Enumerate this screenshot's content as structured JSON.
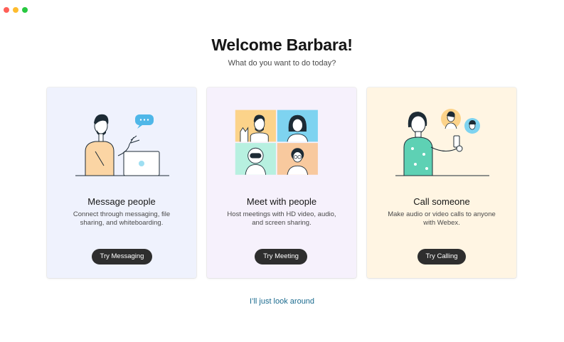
{
  "window": {
    "controls": [
      "close",
      "minimize",
      "zoom"
    ]
  },
  "header": {
    "title": "Welcome Barbara!",
    "subtitle": "What do you want to do today?"
  },
  "cards": [
    {
      "title": "Message people",
      "description": "Connect through messaging, file sharing, and whiteboarding.",
      "button_label": "Try Messaging",
      "icon": "messaging-illustration",
      "background": "#eff2fd"
    },
    {
      "title": "Meet with people",
      "description": "Host meetings with HD video, audio, and screen sharing.",
      "button_label": "Try Meeting",
      "icon": "meeting-illustration",
      "background": "#f6f1fc"
    },
    {
      "title": "Call someone",
      "description": "Make audio or video calls to anyone with Webex.",
      "button_label": "Try Calling",
      "icon": "calling-illustration",
      "background": "#fff5e3"
    }
  ],
  "footer": {
    "link_label": "I’ll just look around"
  },
  "colors": {
    "button": "#2e2e2e",
    "link": "#1b6b8f",
    "accent_cyan": "#7ed3f0"
  }
}
